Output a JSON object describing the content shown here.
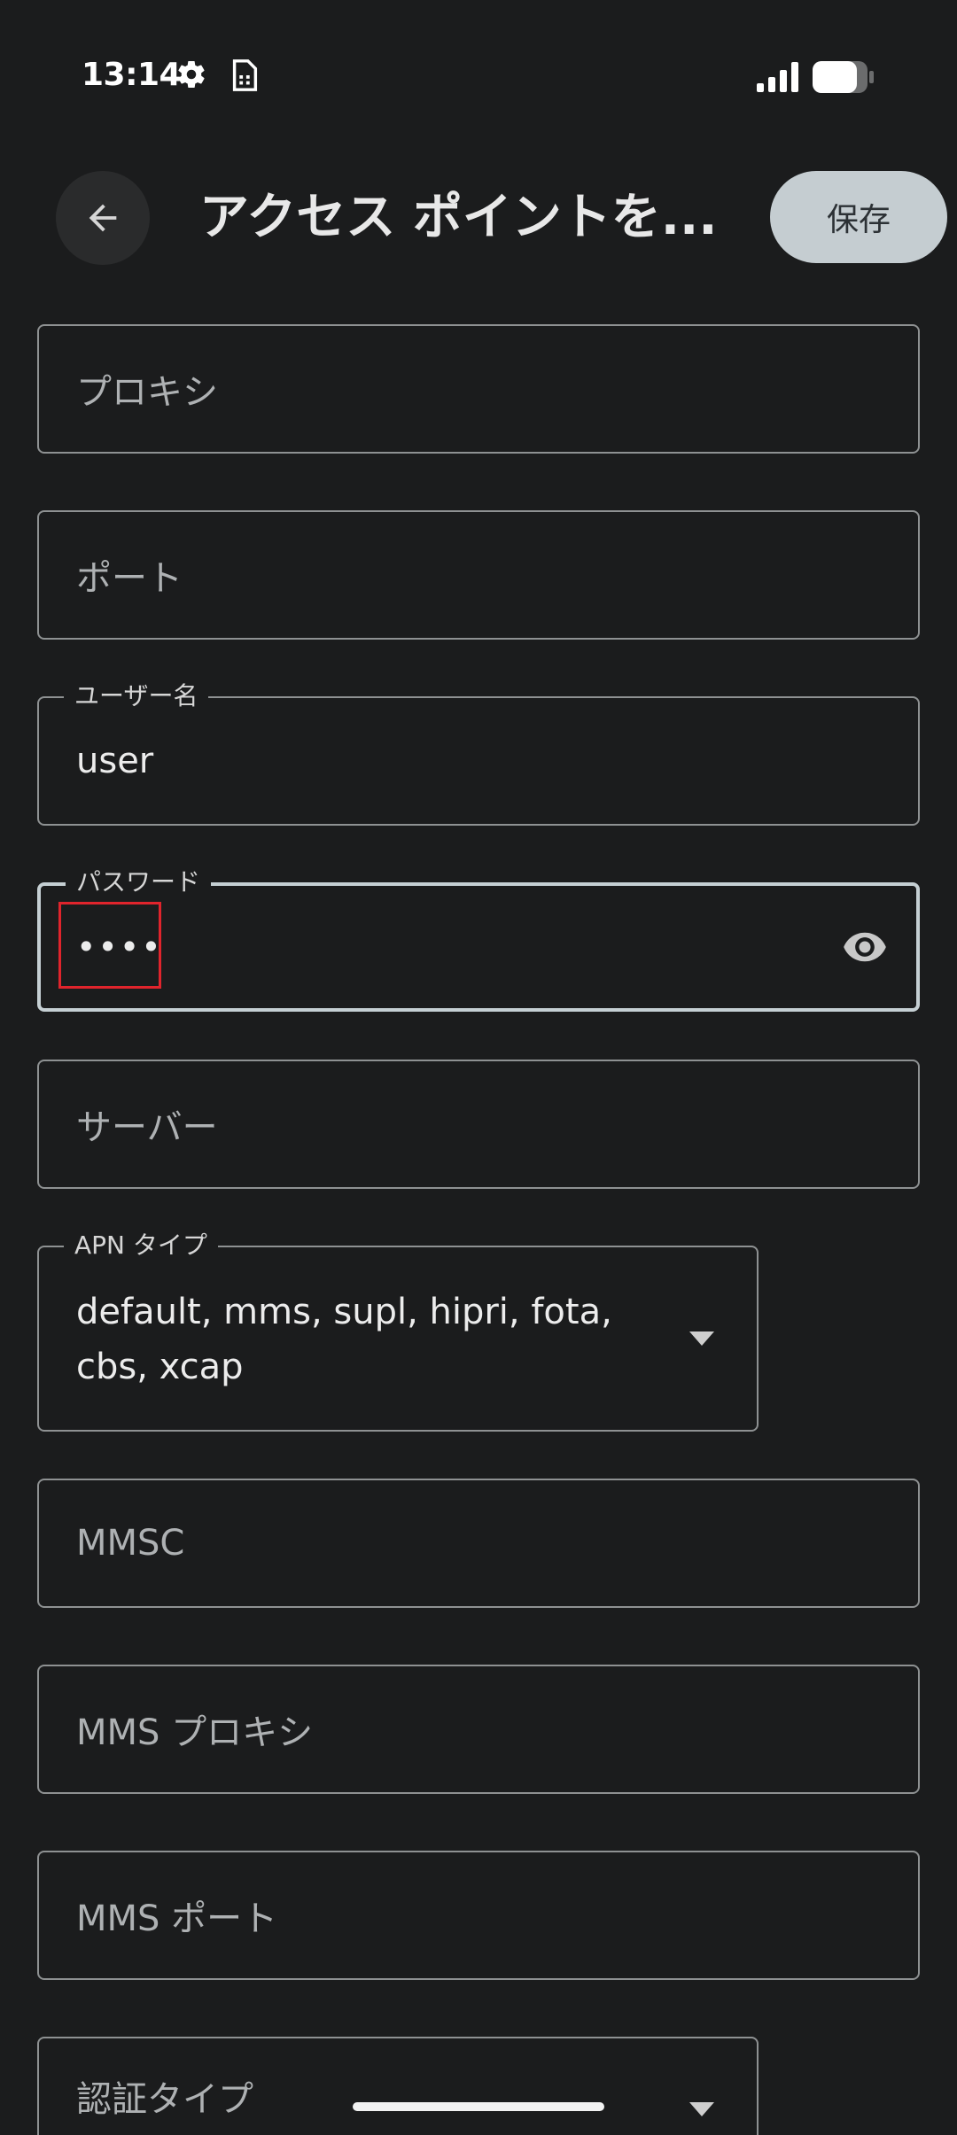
{
  "status_bar": {
    "time": "13:14",
    "icons": [
      "gear-icon",
      "sim-card-icon",
      "cell-signal-icon",
      "battery-icon"
    ]
  },
  "app_bar": {
    "back_icon": "arrow-back-icon",
    "title": "アクセス ポイントを...",
    "save_label": "保存"
  },
  "fields": {
    "proxy": {
      "placeholder": "プロキシ"
    },
    "port": {
      "placeholder": "ポート"
    },
    "username": {
      "label": "ユーザー名",
      "value": "user"
    },
    "password": {
      "label": "パスワード",
      "value": "••••",
      "toggle_icon": "eye-icon"
    },
    "server": {
      "placeholder": "サーバー"
    },
    "apn_type": {
      "label": "APN タイプ",
      "value_line1": "default, mms, supl, hipri, fota,",
      "value_line2": "cbs, xcap"
    },
    "mmsc": {
      "placeholder": "MMSC"
    },
    "mms_proxy": {
      "placeholder": "MMS プロキシ"
    },
    "mms_port": {
      "placeholder": "MMS ポート"
    },
    "auth_type": {
      "placeholder": "認証タイプ"
    }
  },
  "colors": {
    "background": "#1b1c1d",
    "save_button_bg": "#c5cdd1",
    "focused_outline": "#c5cfd3",
    "highlight": "#e0242c"
  }
}
